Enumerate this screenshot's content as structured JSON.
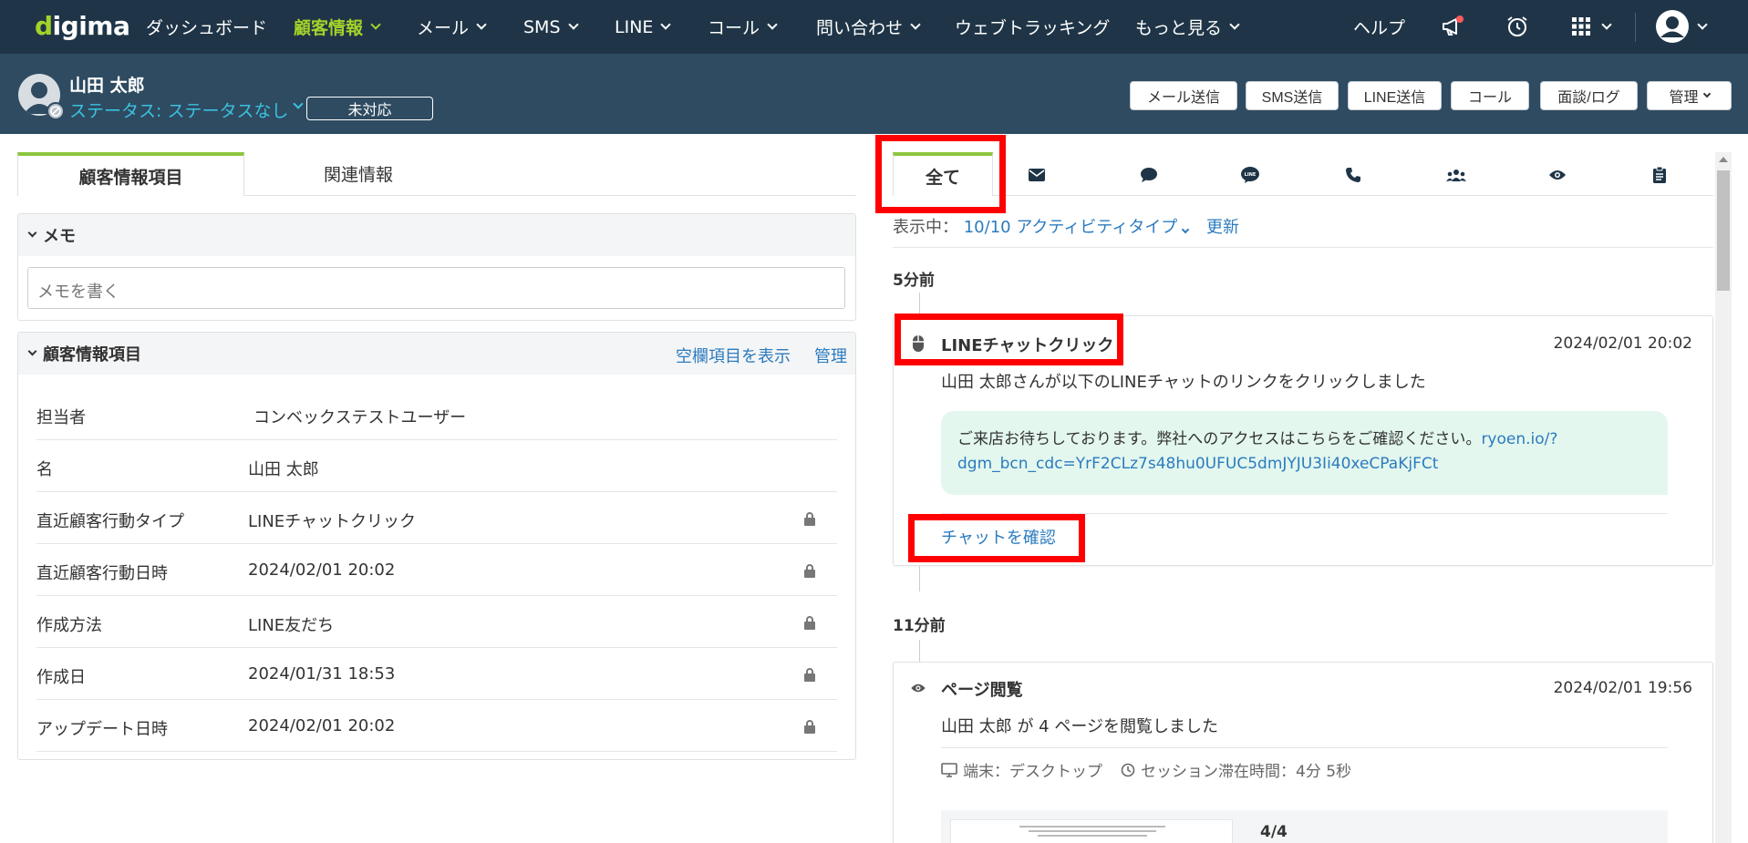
{
  "nav": {
    "logo": "digima",
    "items": [
      {
        "label": "ダッシュボード",
        "active": false,
        "dropdown": false
      },
      {
        "label": "顧客情報",
        "active": true,
        "dropdown": true
      },
      {
        "label": "メール",
        "active": false,
        "dropdown": true
      },
      {
        "label": "SMS",
        "active": false,
        "dropdown": true
      },
      {
        "label": "LINE",
        "active": false,
        "dropdown": true
      },
      {
        "label": "コール",
        "active": false,
        "dropdown": true
      },
      {
        "label": "問い合わせ",
        "active": false,
        "dropdown": true
      },
      {
        "label": "ウェブトラッキング",
        "active": false,
        "dropdown": false
      },
      {
        "label": "もっと見る",
        "active": false,
        "dropdown": true
      }
    ],
    "help_label": "ヘルプ",
    "icons": [
      "megaphone-icon",
      "alarm-clock-icon",
      "apps-grid-icon",
      "user-avatar-icon"
    ],
    "accent_color": "#a4d32a",
    "bg_color": "#1f3547"
  },
  "contact": {
    "name": "山田 太郎",
    "status": "ステータス: ステータスなし",
    "badge": "未対応"
  },
  "header_actions": [
    "メール送信",
    "SMS送信",
    "LINE送信",
    "コール",
    "面談/ログ",
    "管理"
  ],
  "left": {
    "tabs": [
      "顧客情報項目",
      "関連情報"
    ],
    "memo": {
      "title": "メモ",
      "placeholder": "メモを書く"
    },
    "fields_card": {
      "title": "顧客情報項目",
      "show_empty_link": "空欄項目を表示",
      "manage_link": "管理",
      "rows": [
        {
          "label": "担当者",
          "value": "コンベックステストユーザー",
          "locked": false
        },
        {
          "label": "名",
          "value": "山田 太郎",
          "locked": false
        },
        {
          "label": "直近顧客行動タイプ",
          "value": "LINEチャットクリック",
          "locked": true
        },
        {
          "label": "直近顧客行動日時",
          "value": "2024/02/01 20:02",
          "locked": true
        },
        {
          "label": "作成方法",
          "value": "LINE友だち",
          "locked": true
        },
        {
          "label": "作成日",
          "value": "2024/01/31 18:53",
          "locked": true
        },
        {
          "label": "アップデート日時",
          "value": "2024/02/01 20:02",
          "locked": true
        }
      ]
    }
  },
  "right": {
    "tab_all": "全て",
    "tab_icons": [
      "mail-icon",
      "chat-bubble-icon",
      "line-icon",
      "phone-icon",
      "meeting-icon",
      "eye-icon",
      "clipboard-icon"
    ],
    "showing_label": "表示中：",
    "showing_value": "10/10 アクティビティタイプ",
    "refresh": "更新",
    "groups": [
      {
        "time": "5分前",
        "activity": {
          "icon": "mouse-icon",
          "title": "LINEチャットクリック",
          "date": "2024/02/01 20:02",
          "desc": "山田 太郎さんが以下のLINEチャットのリンクをクリックしました",
          "message": "ご来店お待ちしております。弊社へのアクセスはこちらをご確認ください。",
          "message_url_1": "ryoen.io/?",
          "message_url_2": "dgm_bcn_cdc=YrF2CLz7s48hu0UFUC5dmJYJU3Ii40xeCPaKjFCt",
          "link": "チャットを確認"
        }
      },
      {
        "time": "11分前",
        "activity": {
          "icon": "eye-icon",
          "title": "ページ閲覧",
          "date": "2024/02/01 19:56",
          "desc": "山田 太郎 が 4 ページを閲覧しました",
          "device": "端末：デスクトップ",
          "session": "セッション滞在時間：4分 5秒",
          "page_count": "4/4"
        }
      }
    ]
  }
}
